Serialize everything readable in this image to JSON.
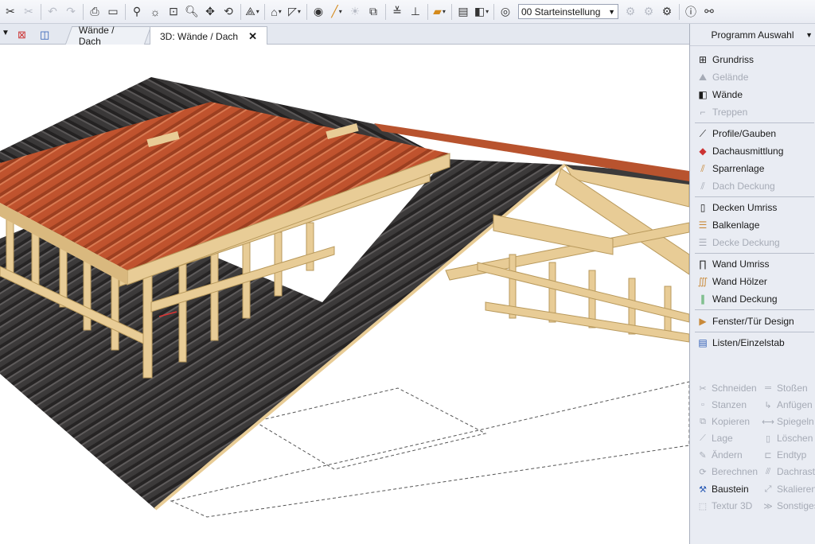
{
  "toolbar": {
    "preset_value": "00 Starteinstellung",
    "icons": [
      "wand-icon",
      "wand-disabled-icon",
      "undo-icon",
      "redo-icon",
      "print-icon",
      "print-preview-icon",
      "measure-icon",
      "light-icon",
      "zoom-window-icon",
      "zoom-icon",
      "pan-icon",
      "orbit-icon",
      "view-3d-icon",
      "section-icon",
      "plane-icon",
      "brush-icon",
      "sun-icon",
      "render-icon",
      "layers-icon",
      "dimension-icon",
      "flag-icon",
      "building-icon",
      "window-layout-icon",
      "eye-icon",
      "snap-icon",
      "settings-gear-icon",
      "info-icon",
      "binoculars-icon"
    ]
  },
  "tabs": [
    {
      "label": "Wände / Dach"
    },
    {
      "label": "3D: Wände / Dach",
      "active": true
    }
  ],
  "panel": {
    "title": "Programm Auswahl",
    "groups": [
      [
        {
          "label": "Grundriss",
          "enabled": true,
          "icon": "floorplan-icon"
        },
        {
          "label": "Gelände",
          "enabled": false,
          "icon": "terrain-icon"
        },
        {
          "label": "Wände",
          "enabled": true,
          "icon": "wall-icon"
        },
        {
          "label": "Treppen",
          "enabled": false,
          "icon": "stairs-icon"
        }
      ],
      [
        {
          "label": "Profile/Gauben",
          "enabled": true,
          "icon": "dormer-icon"
        },
        {
          "label": "Dachausmittlung",
          "enabled": true,
          "icon": "roof-icon"
        },
        {
          "label": "Sparrenlage",
          "enabled": true,
          "icon": "rafter-icon"
        },
        {
          "label": "Dach Deckung",
          "enabled": false,
          "icon": "roof-covering-icon"
        }
      ],
      [
        {
          "label": "Decken Umriss",
          "enabled": true,
          "icon": "ceiling-outline-icon"
        },
        {
          "label": "Balkenlage",
          "enabled": true,
          "icon": "beam-icon"
        },
        {
          "label": "Decke Deckung",
          "enabled": false,
          "icon": "ceiling-cover-icon"
        }
      ],
      [
        {
          "label": "Wand Umriss",
          "enabled": true,
          "icon": "wall-outline-icon"
        },
        {
          "label": "Wand Hölzer",
          "enabled": true,
          "icon": "wall-timber-icon"
        },
        {
          "label": "Wand Deckung",
          "enabled": true,
          "icon": "wall-cover-icon"
        }
      ],
      [
        {
          "label": "Fenster/Tür Design",
          "enabled": true,
          "icon": "window-door-icon"
        }
      ],
      [
        {
          "label": "Listen/Einzelstab",
          "enabled": true,
          "icon": "list-icon"
        }
      ]
    ],
    "commands": [
      {
        "label": "Schneiden",
        "active": false,
        "icon": "scissors-icon"
      },
      {
        "label": "Stoßen",
        "active": false,
        "icon": "join-icon"
      },
      {
        "label": "Stanzen",
        "active": false,
        "icon": "punch-icon"
      },
      {
        "label": "Anfügen",
        "active": false,
        "icon": "append-icon"
      },
      {
        "label": "Kopieren",
        "active": false,
        "icon": "copy-icon"
      },
      {
        "label": "Spiegeln",
        "active": false,
        "icon": "mirror-icon"
      },
      {
        "label": "Lage",
        "active": false,
        "icon": "position-icon"
      },
      {
        "label": "Löschen",
        "active": false,
        "icon": "delete-icon"
      },
      {
        "label": "Ändern",
        "active": false,
        "icon": "edit-icon"
      },
      {
        "label": "Endtyp",
        "active": false,
        "icon": "endtype-icon"
      },
      {
        "label": "Berechnen",
        "active": false,
        "icon": "calculate-icon"
      },
      {
        "label": "Dachraste",
        "active": false,
        "icon": "roof-grid-icon"
      },
      {
        "label": "Baustein",
        "active": true,
        "icon": "component-icon"
      },
      {
        "label": "Skalieren",
        "active": false,
        "icon": "scale-icon"
      },
      {
        "label": "Textur 3D",
        "active": false,
        "icon": "texture-icon"
      },
      {
        "label": "Sonstiges",
        "active": false,
        "icon": "misc-icon"
      }
    ]
  },
  "colors": {
    "roof_red": "#c0532e",
    "roof_dark": "#3c3a3a",
    "timber": "#e8cc96"
  }
}
